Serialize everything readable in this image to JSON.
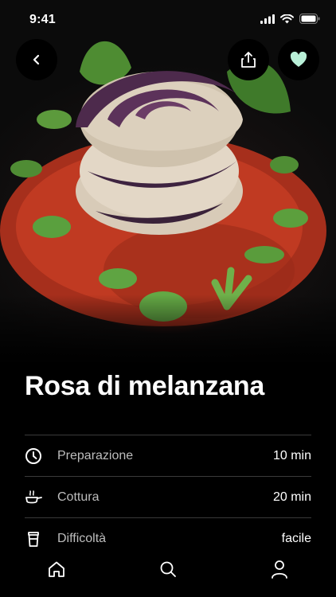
{
  "status_bar": {
    "time": "9:41"
  },
  "recipe": {
    "title": "Rosa di melanzana",
    "info": [
      {
        "icon": "clock-icon",
        "label": "Preparazione",
        "value": "10 min"
      },
      {
        "icon": "pan-icon",
        "label": "Cottura",
        "value": "20 min"
      },
      {
        "icon": "cup-icon",
        "label": "Difficoltà",
        "value": "facile"
      }
    ]
  },
  "colors": {
    "favorite": "#b9f0d8",
    "background": "#000000",
    "divider": "#3a3a3a"
  },
  "tabs": [
    "home-icon",
    "search-icon",
    "profile-icon"
  ]
}
